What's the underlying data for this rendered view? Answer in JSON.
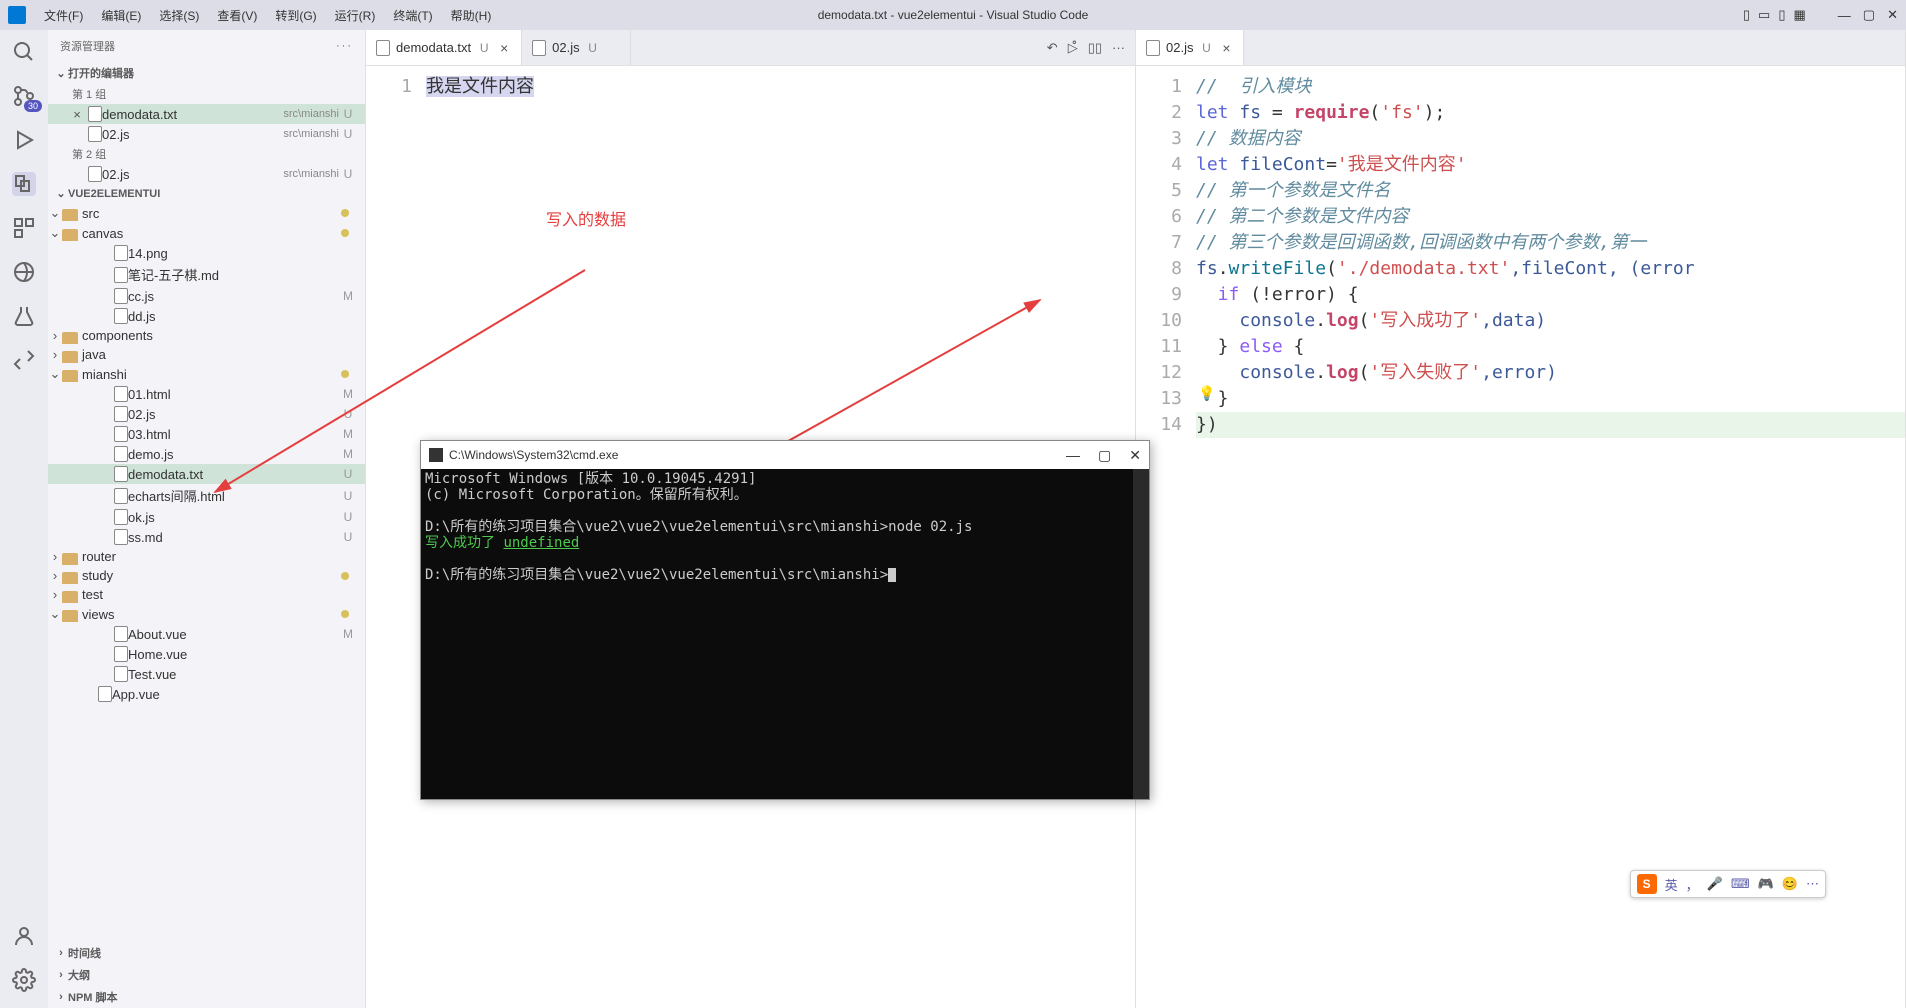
{
  "window": {
    "title": "demodata.txt - vue2elementui - Visual Studio Code"
  },
  "menubar": {
    "items": [
      "文件(F)",
      "编辑(E)",
      "选择(S)",
      "查看(V)",
      "转到(G)",
      "运行(R)",
      "终端(T)",
      "帮助(H)"
    ]
  },
  "activitybar": {
    "badge": "30"
  },
  "sidebar": {
    "title": "资源管理器",
    "actionsLabel": "···",
    "openEditors": {
      "label": "打开的编辑器",
      "groups": [
        {
          "label": "第 1 组",
          "files": [
            {
              "name": "demodata.txt",
              "path": "src\\mianshi",
              "status": "U",
              "active": true
            },
            {
              "name": "02.js",
              "path": "src\\mianshi",
              "status": "U",
              "active": false
            }
          ]
        },
        {
          "label": "第 2 组",
          "files": [
            {
              "name": "02.js",
              "path": "src\\mianshi",
              "status": "U",
              "active": false
            }
          ]
        }
      ]
    },
    "workspace": {
      "name": "VUE2ELEMENTUI",
      "tree": [
        {
          "type": "folder",
          "name": "src",
          "indent": 1,
          "open": true,
          "dot": true
        },
        {
          "type": "folder",
          "name": "canvas",
          "indent": 2,
          "open": true,
          "dot": true
        },
        {
          "type": "file",
          "name": "14.png",
          "indent": 3
        },
        {
          "type": "file",
          "name": "笔记-五子棋.md",
          "indent": 3
        },
        {
          "type": "file",
          "name": "cc.js",
          "indent": 3,
          "status": "M"
        },
        {
          "type": "file",
          "name": "dd.js",
          "indent": 3
        },
        {
          "type": "folder",
          "name": "components",
          "indent": 2,
          "open": false
        },
        {
          "type": "folder",
          "name": "java",
          "indent": 2,
          "open": false
        },
        {
          "type": "folder",
          "name": "mianshi",
          "indent": 2,
          "open": true,
          "dot": true
        },
        {
          "type": "file",
          "name": "01.html",
          "indent": 3,
          "status": "M"
        },
        {
          "type": "file",
          "name": "02.js",
          "indent": 3,
          "status": "U"
        },
        {
          "type": "file",
          "name": "03.html",
          "indent": 3,
          "status": "M"
        },
        {
          "type": "file",
          "name": "demo.js",
          "indent": 3,
          "status": "M"
        },
        {
          "type": "file",
          "name": "demodata.txt",
          "indent": 3,
          "status": "U",
          "selected": true
        },
        {
          "type": "file",
          "name": "echarts间隔.html",
          "indent": 3,
          "status": "U"
        },
        {
          "type": "file",
          "name": "ok.js",
          "indent": 3,
          "status": "U"
        },
        {
          "type": "file",
          "name": "ss.md",
          "indent": 3,
          "status": "U"
        },
        {
          "type": "folder",
          "name": "router",
          "indent": 2,
          "open": false
        },
        {
          "type": "folder",
          "name": "study",
          "indent": 2,
          "open": false,
          "dot": true
        },
        {
          "type": "folder",
          "name": "test",
          "indent": 2,
          "open": false
        },
        {
          "type": "folder",
          "name": "views",
          "indent": 2,
          "open": true,
          "dot": true
        },
        {
          "type": "file",
          "name": "About.vue",
          "indent": 3,
          "status": "M"
        },
        {
          "type": "file",
          "name": "Home.vue",
          "indent": 3
        },
        {
          "type": "file",
          "name": "Test.vue",
          "indent": 3
        },
        {
          "type": "file",
          "name": "App.vue",
          "indent": 2
        }
      ]
    },
    "bottomSections": [
      "时间线",
      "大纲",
      "NPM 脚本"
    ]
  },
  "editorLeft": {
    "tabs": [
      {
        "name": "demodata.txt",
        "status": "U",
        "active": true,
        "closable": true
      },
      {
        "name": "02.js",
        "status": "U",
        "active": false,
        "closable": false
      }
    ],
    "lineNumbers": [
      "1"
    ],
    "content": "我是文件内容",
    "annotation": "写入的数据"
  },
  "editorRight": {
    "tabs": [
      {
        "name": "02.js",
        "status": "U",
        "active": true,
        "closable": true
      }
    ],
    "lineNumbers": [
      "1",
      "2",
      "3",
      "4",
      "5",
      "6",
      "7",
      "8",
      "9",
      "10",
      "11",
      "12",
      "13",
      "14"
    ],
    "code": {
      "l1": "//  引入模块",
      "l2_let": "let",
      "l2_fs": " fs ",
      "l2_eq": "= ",
      "l2_req": "require",
      "l2_arg": "('fs');",
      "l2_str": "'fs'",
      "l3": "// 数据内容",
      "l4_let": "let",
      "l4_var": " fileCont",
      "l4_eq": "=",
      "l4_str": "'我是文件内容'",
      "l5": "// 第一个参数是文件名",
      "l6": "// 第二个参数是文件内容",
      "l7": "// 第三个参数是回调函数,回调函数中有两个参数,第一",
      "l8_fs": "fs",
      "l8_dot": ".",
      "l8_wr": "writeFile",
      "l8_p1": "(",
      "l8_str": "'./demodata.txt'",
      "l8_c": ",fileCont, (error",
      "l9_if": "  if",
      "l9_cond": " (!error) {",
      "l10_pre": "    ",
      "l10_cons": "console",
      "l10_dot": ".",
      "l10_log": "log",
      "l10_p": "(",
      "l10_str": "'写入成功了'",
      "l10_rest": ",data)",
      "l11": "  } ",
      "l11_else": "else",
      "l11_b": " {",
      "l12_pre": "    ",
      "l12_cons": "console",
      "l12_dot": ".",
      "l12_log": "log",
      "l12_p": "(",
      "l12_str": "'写入失败了'",
      "l12_rest": ",error)",
      "l13": "  }",
      "l14": "})"
    }
  },
  "terminal": {
    "title": "C:\\Windows\\System32\\cmd.exe",
    "lines": {
      "l1": "Microsoft Windows [版本 10.0.19045.4291]",
      "l2": "(c) Microsoft Corporation。保留所有权利。",
      "l3": "",
      "l4": "D:\\所有的练习项目集合\\vue2\\vue2\\vue2elementui\\src\\mianshi>node 02.js",
      "l5a": "写入成功了 ",
      "l5b": "undefined",
      "l6": "",
      "l7": "D:\\所有的练习项目集合\\vue2\\vue2\\vue2elementui\\src\\mianshi>"
    }
  },
  "ime": {
    "lang": "英",
    "icons": [
      "，",
      "🎤",
      "⌨",
      "🎮",
      "😊",
      "⋯"
    ]
  }
}
